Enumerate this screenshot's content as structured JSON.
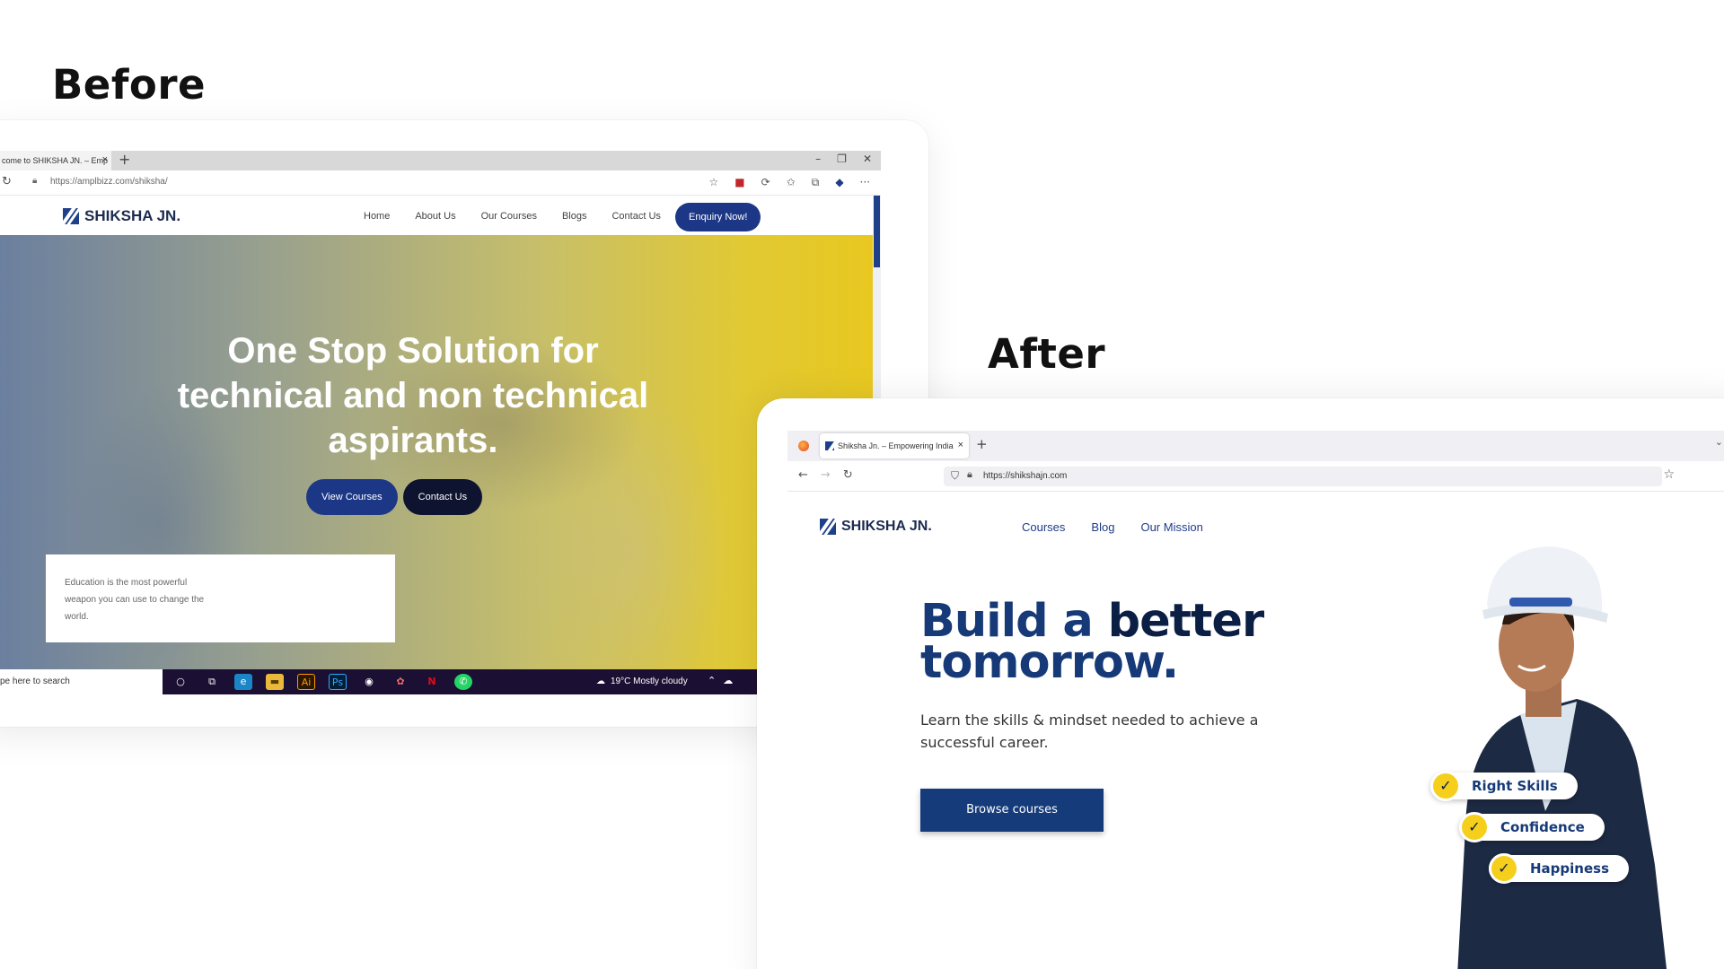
{
  "labels": {
    "before": "Before",
    "after": "After"
  },
  "before": {
    "tab_title": "come to SHIKSHA JN. – Emp",
    "url": "https://amplbizz.com/shiksha/",
    "logo": "SHIKSHA JN.",
    "menu": [
      "Home",
      "About Us",
      "Our Courses",
      "Blogs",
      "Contact Us"
    ],
    "enquiry": "Enquiry Now!",
    "hero_title": "One Stop Solution for technical and non technical aspirants.",
    "btn_courses": "View Courses",
    "btn_contact": "Contact Us",
    "quote": "Education is the most powerful weapon you can use to change the world.",
    "taskbar": {
      "search": "pe here to search",
      "weather": "19°C  Mostly cloudy"
    }
  },
  "after": {
    "tab_title": "Shiksha Jn. – Empowering India",
    "url": "https://shikshajn.com",
    "logo": "SHIKSHA JN.",
    "menu": [
      "Courses",
      "Blog",
      "Our Mission"
    ],
    "headline_line1_a": "Build a ",
    "headline_line1_b": "better",
    "headline_line2": "tomorrow.",
    "subtitle": "Learn the skills & mindset needed to achieve a successful career.",
    "cta": "Browse courses",
    "badges": [
      "Right Skills",
      "Confidence",
      "Happiness"
    ]
  },
  "colors": {
    "brand_navy": "#163977",
    "brand_yellow": "#f5cf1b",
    "old_brand_blue": "#1c3785"
  }
}
